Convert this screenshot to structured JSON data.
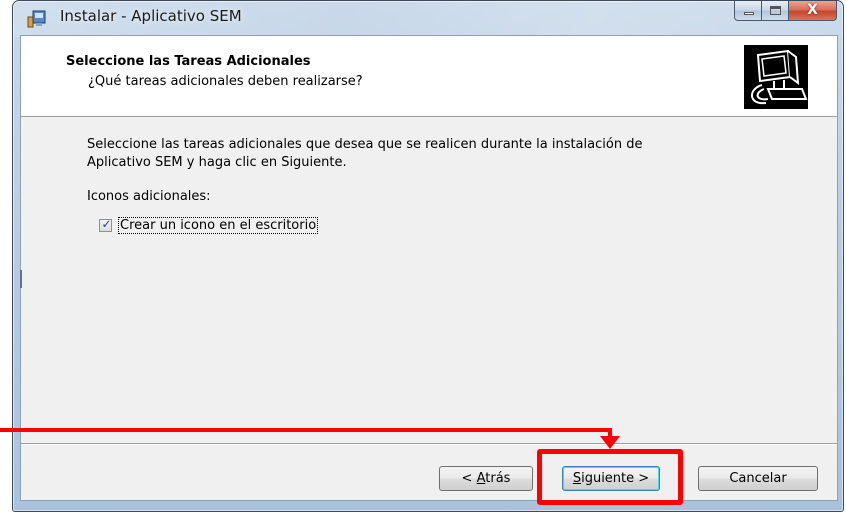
{
  "window": {
    "title": "Instalar - Aplicativo SEM",
    "controls": {
      "minimize_icon": "minimize-icon",
      "maximize_icon": "maximize-icon",
      "close_label": "X"
    }
  },
  "header": {
    "title": "Seleccione las Tareas Adicionales",
    "subtitle": "¿Qué tareas adicionales deben realizarse?",
    "image_icon": "computer-installer-icon"
  },
  "body": {
    "description_line1": "Seleccione las tareas adicionales que desea que se realicen durante la instalación de",
    "description_line2": "Aplicativo SEM y haga clic en Siguiente.",
    "group_label": "Iconos adicionales:",
    "tasks": [
      {
        "label": "Crear un icono en el escritorio",
        "checked": true
      }
    ]
  },
  "footer": {
    "back_label_prefix": "< ",
    "back_label_access": "A",
    "back_label_rest": "trás",
    "next_label_access": "S",
    "next_label_rest": "iguiente >",
    "cancel_label": "Cancelar"
  },
  "annotation": {
    "color": "#ff0000",
    "target": "next-button"
  },
  "colors": {
    "client_bg": "#f0f0f0",
    "header_bg": "#ffffff",
    "frame": "#b9cde2"
  }
}
